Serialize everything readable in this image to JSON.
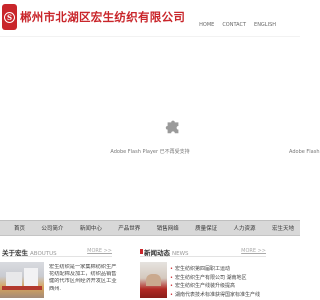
{
  "header": {
    "logo_letter": "S",
    "company_name": "郴州市北湖区宏生纺织有限公司",
    "top_links": [
      "HOME",
      "CONTACT",
      "ENGLISH"
    ]
  },
  "banner": {
    "flash_message": "Adobe Flash Player 已不再受支持",
    "side_text": "Adobe Flash"
  },
  "nav": {
    "items": [
      "首页",
      "公司简介",
      "新闻中心",
      "产品世界",
      "销售网络",
      "质量保证",
      "人力资源",
      "宏生天地"
    ]
  },
  "about": {
    "title": "关于宏生",
    "title_en": "ABOUTUS",
    "more": "MORE >>",
    "lines": [
      "宏生纺织是一家集棉纺织生产、销",
      "花纺配棉及加工，纺织品销售于一体，",
      "健的代市区州经济开发区工业企业，广",
      "西州."
    ]
  },
  "news": {
    "title": "新闻动态",
    "title_en": "NEWS",
    "more": "MORE >>",
    "items": [
      "宏生纺织第四届职工运动",
      "宏生纺织生产有限公司 湖南地区",
      "宏生纺织生产线装升级提高",
      "湖南代表技术标准获得国家标准生产线"
    ]
  },
  "colors": {
    "brand_red": "#c9262b",
    "nav_bg": "#d8d8d8"
  }
}
